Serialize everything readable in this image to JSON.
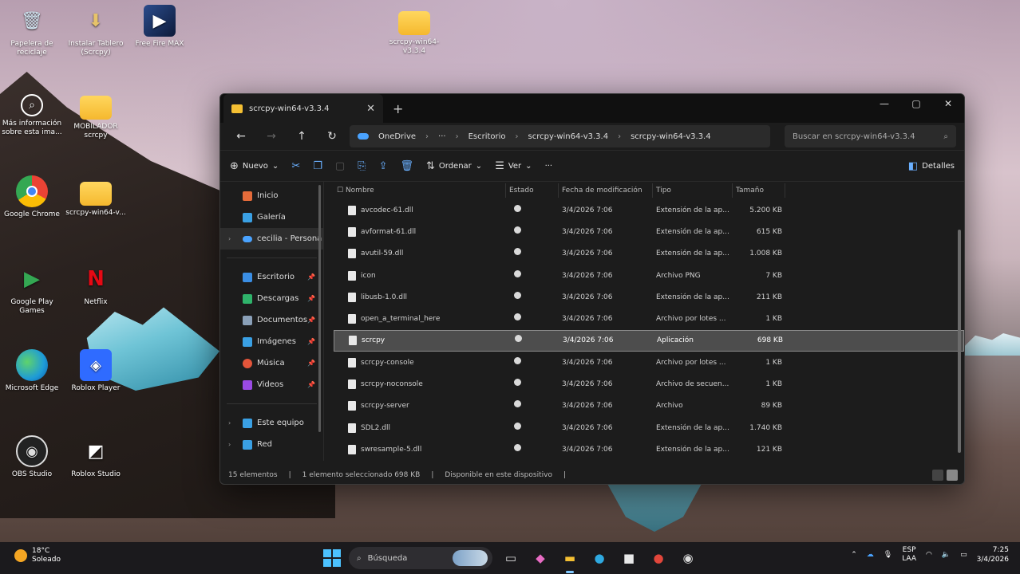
{
  "desktop": {
    "icons": [
      {
        "label": "Papelera de reciclaje",
        "icon": "recycle-bin-icon"
      },
      {
        "label": "Instalar Tablero (Scrcpy)",
        "icon": "installer-icon"
      },
      {
        "label": "Free Fire MAX",
        "icon": "game-icon"
      },
      {
        "label": "scrcpy-win64-v3.3.4",
        "icon": "folder-icon"
      },
      {
        "label": "Más información sobre esta ima...",
        "icon": "info-icon"
      },
      {
        "label": "MOBILADOR scrcpy",
        "icon": "folder-icon"
      },
      {
        "label": "Google Chrome",
        "icon": "chrome-icon"
      },
      {
        "label": "scrcpy-win64-v...",
        "icon": "folder-icon"
      },
      {
        "label": "Google Play Games",
        "icon": "play-games-icon"
      },
      {
        "label": "Netflix",
        "icon": "netflix-icon"
      },
      {
        "label": "Microsoft Edge",
        "icon": "edge-icon"
      },
      {
        "label": "Roblox Player",
        "icon": "roblox-icon"
      },
      {
        "label": "OBS Studio",
        "icon": "obs-icon"
      },
      {
        "label": "Roblox Studio",
        "icon": "roblox-studio-icon"
      }
    ]
  },
  "window": {
    "tab_title": "scrcpy-win64-v3.3.4",
    "tab_close": "✕",
    "new_tab": "+",
    "controls": {
      "minimize": "—",
      "maximize": "▢",
      "close": "✕"
    },
    "nav": {
      "back": "←",
      "forward": "→",
      "up": "↑",
      "refresh": "↻"
    },
    "breadcrumb": [
      "OneDrive",
      "Escritorio",
      "scrcpy-win64-v3.3.4",
      "scrcpy-win64-v3.3.4"
    ],
    "breadcrumb_more": "···",
    "search_placeholder": "Buscar en scrcpy-win64-v3.3.4",
    "toolbar": {
      "new_label": "Nuevo",
      "sort_label": "Ordenar",
      "view_label": "Ver",
      "more_label": "···",
      "details_label": "Detalles"
    },
    "nav_pane": {
      "top": [
        {
          "label": "Inicio",
          "icon": "home-icon",
          "color": "#e46b3a"
        },
        {
          "label": "Galería",
          "icon": "gallery-icon",
          "color": "#3aa0e4"
        },
        {
          "label": "cecilia - Persona",
          "icon": "onedrive-icon",
          "color": "#4aa3ff"
        }
      ],
      "quick": [
        {
          "label": "Escritorio",
          "icon": "desktop-icon",
          "color": "#3a8ee4"
        },
        {
          "label": "Descargas",
          "icon": "downloads-icon",
          "color": "#2fb36b"
        },
        {
          "label": "Documentos",
          "icon": "documents-icon",
          "color": "#8aa0b8"
        },
        {
          "label": "Imágenes",
          "icon": "pictures-icon",
          "color": "#3aa0e4"
        },
        {
          "label": "Música",
          "icon": "music-icon",
          "color": "#e4553a"
        },
        {
          "label": "Videos",
          "icon": "videos-icon",
          "color": "#9a4ae4"
        }
      ],
      "bottom": [
        {
          "label": "Este equipo",
          "icon": "this-pc-icon",
          "color": "#3aa0e4"
        },
        {
          "label": "Red",
          "icon": "network-icon",
          "color": "#3aa0e4"
        }
      ]
    },
    "columns": {
      "name": "Nombre",
      "status": "Estado",
      "date": "Fecha de modificación",
      "type": "Tipo",
      "size": "Tamaño"
    },
    "files": [
      {
        "name": "avcodec-61.dll",
        "date": "3/4/2026 7:06",
        "type": "Extensión de la ap...",
        "size": "5.200 KB"
      },
      {
        "name": "avformat-61.dll",
        "date": "3/4/2026 7:06",
        "type": "Extensión de la ap...",
        "size": "615 KB"
      },
      {
        "name": "avutil-59.dll",
        "date": "3/4/2026 7:06",
        "type": "Extensión de la ap...",
        "size": "1.008 KB"
      },
      {
        "name": "icon",
        "date": "3/4/2026 7:06",
        "type": "Archivo PNG",
        "size": "7 KB"
      },
      {
        "name": "libusb-1.0.dll",
        "date": "3/4/2026 7:06",
        "type": "Extensión de la ap...",
        "size": "211 KB"
      },
      {
        "name": "open_a_terminal_here",
        "date": "3/4/2026 7:06",
        "type": "Archivo por lotes ...",
        "size": "1 KB"
      },
      {
        "name": "scrcpy",
        "date": "3/4/2026 7:06",
        "type": "Aplicación",
        "size": "698 KB",
        "selected": true
      },
      {
        "name": "scrcpy-console",
        "date": "3/4/2026 7:06",
        "type": "Archivo por lotes ...",
        "size": "1 KB"
      },
      {
        "name": "scrcpy-noconsole",
        "date": "3/4/2026 7:06",
        "type": "Archivo de secuen...",
        "size": "1 KB"
      },
      {
        "name": "scrcpy-server",
        "date": "3/4/2026 7:06",
        "type": "Archivo",
        "size": "89 KB"
      },
      {
        "name": "SDL2.dll",
        "date": "3/4/2026 7:06",
        "type": "Extensión de la ap...",
        "size": "1.740 KB"
      },
      {
        "name": "swresample-5.dll",
        "date": "3/4/2026 7:06",
        "type": "Extensión de la ap...",
        "size": "121 KB"
      }
    ],
    "statusbar": {
      "count": "15 elementos",
      "selection": "1 elemento seleccionado  698 KB",
      "availability": "Disponible en este dispositivo"
    }
  },
  "taskbar": {
    "weather_temp": "18°C",
    "weather_desc": "Soleado",
    "search_label": "Búsqueda",
    "apps": [
      {
        "icon": "task-view-icon",
        "glyph": "▭",
        "color": "#dddddd"
      },
      {
        "icon": "copilot-icon",
        "glyph": "◆",
        "color": "#e86cc4"
      },
      {
        "icon": "file-explorer-icon",
        "glyph": "▬",
        "color": "#f5c033",
        "active": true
      },
      {
        "icon": "edge-icon",
        "glyph": "●",
        "color": "#2fa9e0"
      },
      {
        "icon": "store-icon",
        "glyph": "■",
        "color": "#e8e8e8"
      },
      {
        "icon": "chrome-icon",
        "glyph": "●",
        "color": "#e2463b"
      },
      {
        "icon": "obs-icon",
        "glyph": "◉",
        "color": "#dddddd"
      }
    ],
    "lang_1": "ESP",
    "lang_2": "LAA",
    "time": "7:25",
    "date": "3/4/2026"
  }
}
